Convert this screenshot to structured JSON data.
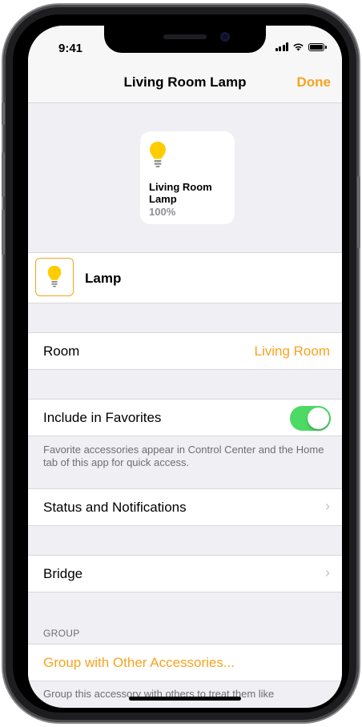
{
  "status_bar": {
    "time": "9:41"
  },
  "nav": {
    "title": "Living Room Lamp",
    "done_label": "Done"
  },
  "tile": {
    "name": "Living Room Lamp",
    "value": "100%"
  },
  "accessory": {
    "name": "Lamp"
  },
  "room": {
    "label": "Room",
    "value": "Living Room"
  },
  "favorites": {
    "label": "Include in Favorites",
    "enabled": true,
    "footnote": "Favorite accessories appear in Control Center and the Home tab of this app for quick access."
  },
  "status_notifications": {
    "label": "Status and Notifications"
  },
  "bridge": {
    "label": "Bridge"
  },
  "group": {
    "header": "GROUP",
    "action_label": "Group with Other Accessories...",
    "footnote": "Group this accessory with others to treat them like"
  },
  "icons": {
    "chevron": "›",
    "bulb": "lightbulb-icon"
  },
  "colors": {
    "accent": "#f7a31f",
    "toggle_on": "#4cd964",
    "background": "#efeff4",
    "bulb_yellow": "#ffcc00"
  }
}
